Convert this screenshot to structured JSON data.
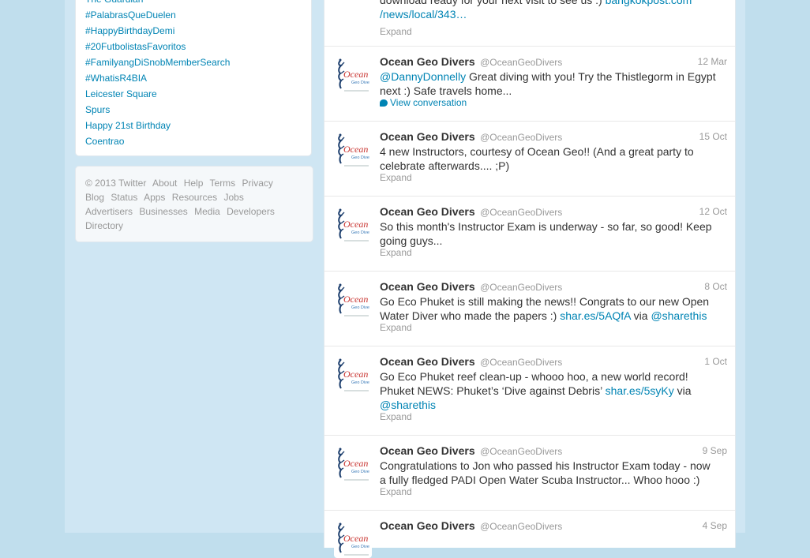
{
  "trends": [
    "The Guardian",
    "#PalabrasQueDuelen",
    "#HappyBirthdayDemi",
    "#20FutbolistasFavoritos",
    "#FamilyangDiSnobMemberSearch",
    "#WhatisR4BIA",
    "Leicester Square",
    "Spurs",
    "Happy 21st Birthday",
    "Coentrao"
  ],
  "footer": {
    "line1": [
      "© 2013 Twitter",
      "About",
      "Help",
      "Terms",
      "Privacy"
    ],
    "line2": [
      "Blog",
      "Status",
      "Apps",
      "Resources",
      "Jobs"
    ],
    "line3": [
      "Advertisers",
      "Businesses",
      "Media",
      "Developers"
    ],
    "line4": [
      "Directory"
    ]
  },
  "avatar_text": {
    "main": "Ocean",
    "sub": "Geo Dive"
  },
  "tweets": [
    {
      "line1_text": "download ready for your next visit to see us :) ",
      "line1_link": "bangkokpost.com",
      "line2_link": "/news/local/343…",
      "action": "Expand"
    },
    {
      "name": "Ocean Geo Divers",
      "handle": "@OceanGeoDivers",
      "time": "12 Mar",
      "mention": "@DannyDonnelly",
      "text_a": " Great diving with you!  Try the Thistlegorm in Egypt",
      "text_b": "next :)  Safe travels home...",
      "action": "View conversation"
    },
    {
      "name": "Ocean Geo Divers",
      "handle": "@OceanGeoDivers",
      "time": "15 Oct",
      "text_a": "4 new Instructors, courtesy of Ocean Geo!! (And a great party to",
      "text_b": "celebrate afterwards.... ;P)",
      "action": "Expand"
    },
    {
      "name": "Ocean Geo Divers",
      "handle": "@OceanGeoDivers",
      "time": "12 Oct",
      "text_a": "So this month's Instructor Exam is underway - so far, so good!  Keep",
      "text_b": "going guys...",
      "action": "Expand"
    },
    {
      "name": "Ocean Geo Divers",
      "handle": "@OceanGeoDivers",
      "time": "8 Oct",
      "text_a": "Go Eco Phuket is still making the news!! Congrats to our new Open",
      "text_b": "Water Diver who made the papers :) ",
      "link1": "shar.es/5AQfA",
      "via": " via ",
      "link2": "@sharethis",
      "action": "Expand"
    },
    {
      "name": "Ocean Geo Divers",
      "handle": "@OceanGeoDivers",
      "time": "1 Oct",
      "text_a": "Go Eco Phuket reef clean-up - whooo hoo, a new world record!",
      "text_b": "Phuket NEWS: Phuket’s ‘Dive against Debris’ ",
      "link1": "shar.es/5syKy",
      "via": " via",
      "link2": "@sharethis",
      "action": "Expand"
    },
    {
      "name": "Ocean Geo Divers",
      "handle": "@OceanGeoDivers",
      "time": "9 Sep",
      "text_a": "Congratulations to Jon who passed his Instructor Exam today - now",
      "text_b": "a fully fledged PADI Open Water Scuba Instructor... Whoo hooo :)",
      "action": "Expand"
    },
    {
      "name": "Ocean Geo Divers",
      "handle": "@OceanGeoDivers",
      "time": "4 Sep"
    }
  ],
  "colors": {
    "link": "#0084b4",
    "background": "#c0deed",
    "avatar_red": "#c8322e",
    "avatar_blue": "#3a7ab8"
  }
}
